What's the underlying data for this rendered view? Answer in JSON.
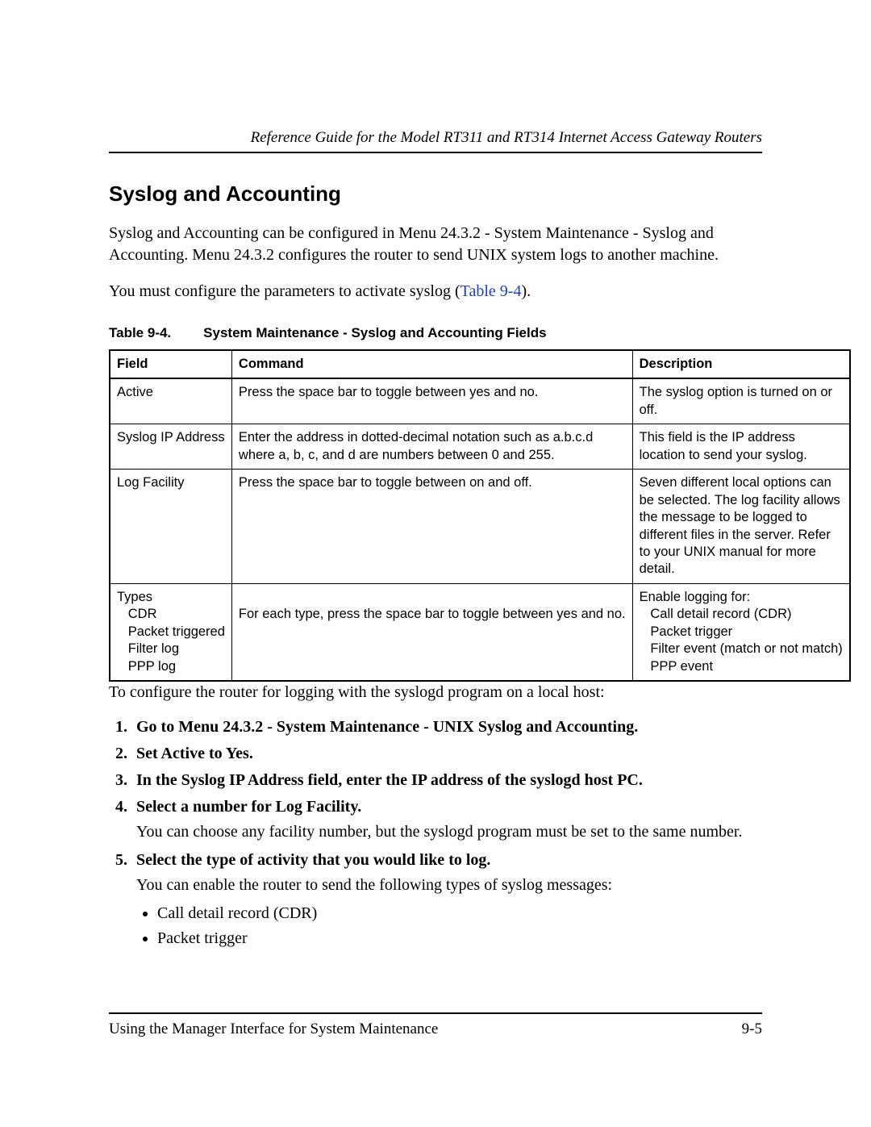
{
  "header": {
    "running_title": "Reference Guide for the Model RT311 and RT314 Internet Access Gateway Routers"
  },
  "section": {
    "title": "Syslog and Accounting",
    "para1": "Syslog and Accounting can be configured in Menu 24.3.2 - System Maintenance - Syslog and Accounting. Menu 24.3.2 configures the router to send UNIX system logs to another machine.",
    "para2_pre": "You must configure the parameters to activate syslog (",
    "para2_link": "Table 9-4",
    "para2_post": ")."
  },
  "table": {
    "label": "Table 9-4.",
    "title": "System Maintenance - Syslog and Accounting Fields",
    "headers": {
      "c1": "Field",
      "c2": "Command",
      "c3": "Description"
    },
    "rows": [
      {
        "field": "Active",
        "command": "Press the space bar to toggle between yes and no.",
        "desc": "The syslog option is turned on or off."
      },
      {
        "field": "Syslog IP Address",
        "command": "Enter the address in dotted-decimal notation such as a.b.c.d where a, b, c, and d are numbers between 0 and 255.",
        "desc": "This field is the IP address location to send your syslog."
      },
      {
        "field": "Log Facility",
        "command": "Press the space bar to toggle between on and off.",
        "desc": "Seven different local options can be selected. The log facility allows the message to be logged to different files in the server. Refer to your UNIX manual for more detail."
      },
      {
        "field": "Types\n   CDR\n   Packet triggered\n   Filter log\n   PPP log",
        "command": "\nFor each type, press the space bar to toggle between yes and no.",
        "desc": "Enable logging for:\n   Call detail record (CDR)\n   Packet trigger\n   Filter event (match or not match)\n   PPP event"
      }
    ]
  },
  "config_intro": "To configure the router for logging with the syslogd program on a local host:",
  "steps": {
    "s1": "Go to Menu 24.3.2 - System Maintenance - UNIX Syslog and Accounting.",
    "s2": "Set Active to Yes.",
    "s3": "In the Syslog IP Address field, enter the IP address of the syslogd host PC.",
    "s4": "Select a number for Log Facility.",
    "s4_sub": "You can choose any facility number, but the syslogd program must be set to the same number.",
    "s5": "Select the type of activity that you would like to log.",
    "s5_sub": "You can enable the router to send the following types of syslog messages:",
    "s5_b1": "Call detail record (CDR)",
    "s5_b2": "Packet trigger"
  },
  "footer": {
    "left": "Using the Manager Interface for System Maintenance",
    "right": "9-5"
  }
}
